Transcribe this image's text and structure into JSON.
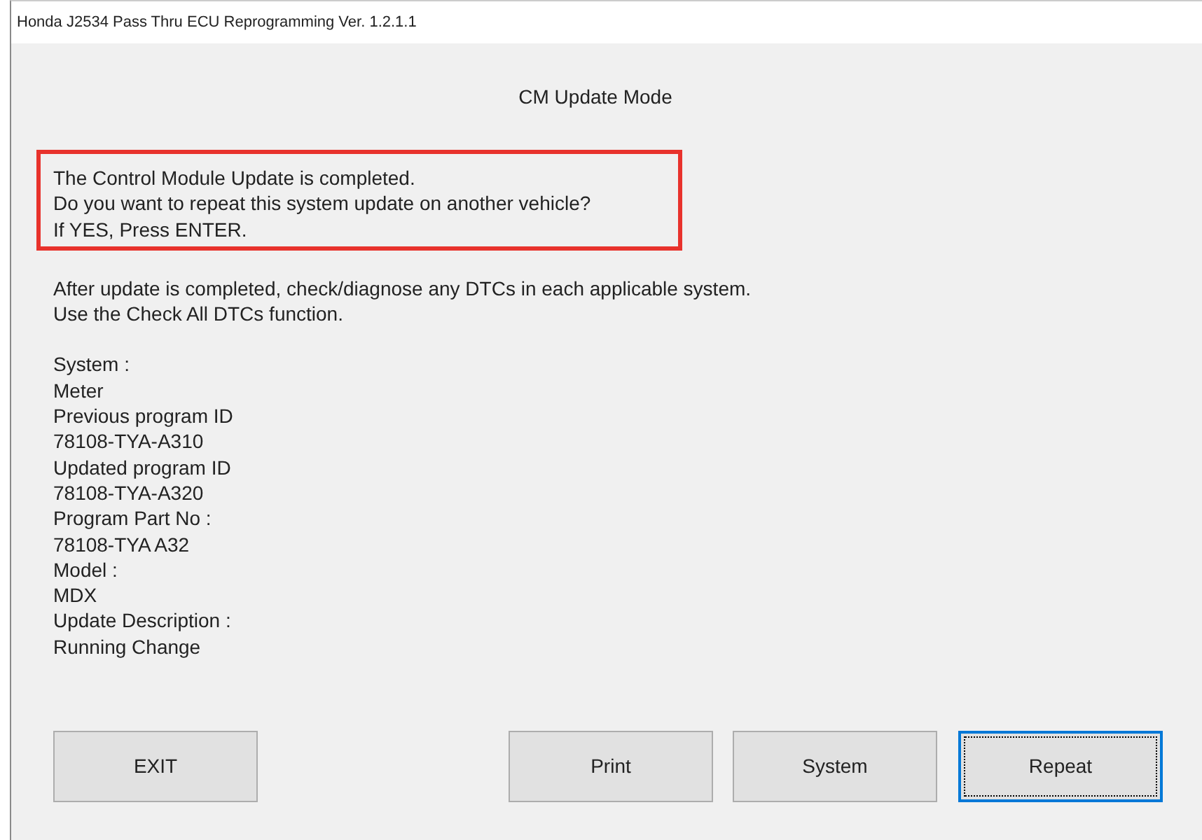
{
  "window": {
    "title": "Honda J2534 Pass Thru ECU Reprogramming Ver. 1.2.1.1"
  },
  "heading": "CM Update Mode",
  "highlighted_message": [
    "The Control Module Update is completed.",
    "Do you want to repeat this system update on another vehicle?",
    "If YES, Press ENTER."
  ],
  "instructions": [
    "After update is completed, check/diagnose any DTCs in each applicable system.",
    "Use the Check All DTCs function."
  ],
  "details": [
    "System :",
    "Meter",
    "Previous program ID",
    "78108-TYA-A310",
    "Updated program ID",
    "78108-TYA-A320",
    "Program Part No :",
    "78108-TYA A32",
    "Model :",
    "MDX",
    "Update Description :",
    "Running Change"
  ],
  "buttons": [
    {
      "label": "EXIT",
      "focused": false
    },
    {
      "label": "Print",
      "focused": false
    },
    {
      "label": "System",
      "focused": false
    },
    {
      "label": "Repeat",
      "focused": true
    }
  ]
}
